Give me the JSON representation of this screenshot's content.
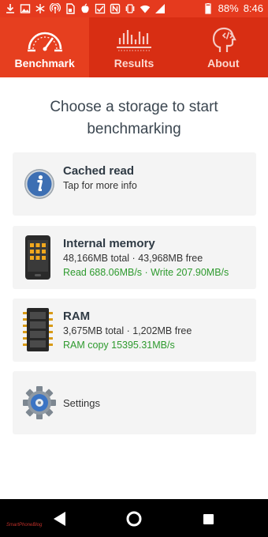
{
  "status_bar": {
    "icons_left": [
      "download-icon",
      "image-icon",
      "snowflake-icon",
      "hotspot-icon",
      "sim-icon",
      "apple-icon",
      "check-icon",
      "nfc-icon",
      "vibrate-icon",
      "wifi-icon",
      "signal-icon"
    ],
    "battery_percent": "88%",
    "time": "8:46"
  },
  "tabs": [
    {
      "label": "Benchmark",
      "icon": "speedometer-icon",
      "active": true
    },
    {
      "label": "Results",
      "icon": "bar-chart-icon",
      "active": false
    },
    {
      "label": "About",
      "icon": "head-code-icon",
      "active": false
    }
  ],
  "heading": "Choose a storage to start benchmarking",
  "cards": {
    "cached": {
      "title": "Cached read",
      "line1": "Tap for more info",
      "icon": "info-icon"
    },
    "internal": {
      "title": "Internal memory",
      "line1": "48,166MB total · 43,968MB free",
      "line2": "Read 688.06MB/s · Write 207.90MB/s",
      "icon": "phone-memory-icon"
    },
    "ram": {
      "title": "RAM",
      "line1": "3,675MB total · 1,202MB free",
      "line2": "RAM copy 15395.31MB/s",
      "icon": "ram-chip-icon"
    },
    "settings": {
      "title": "Settings",
      "icon": "gear-icon"
    }
  },
  "nav": {
    "watermark": "SmartPhoneBlog"
  },
  "colors": {
    "accent": "#e53a1e",
    "green": "#2e9a2e",
    "card_bg": "#f4f4f4"
  }
}
